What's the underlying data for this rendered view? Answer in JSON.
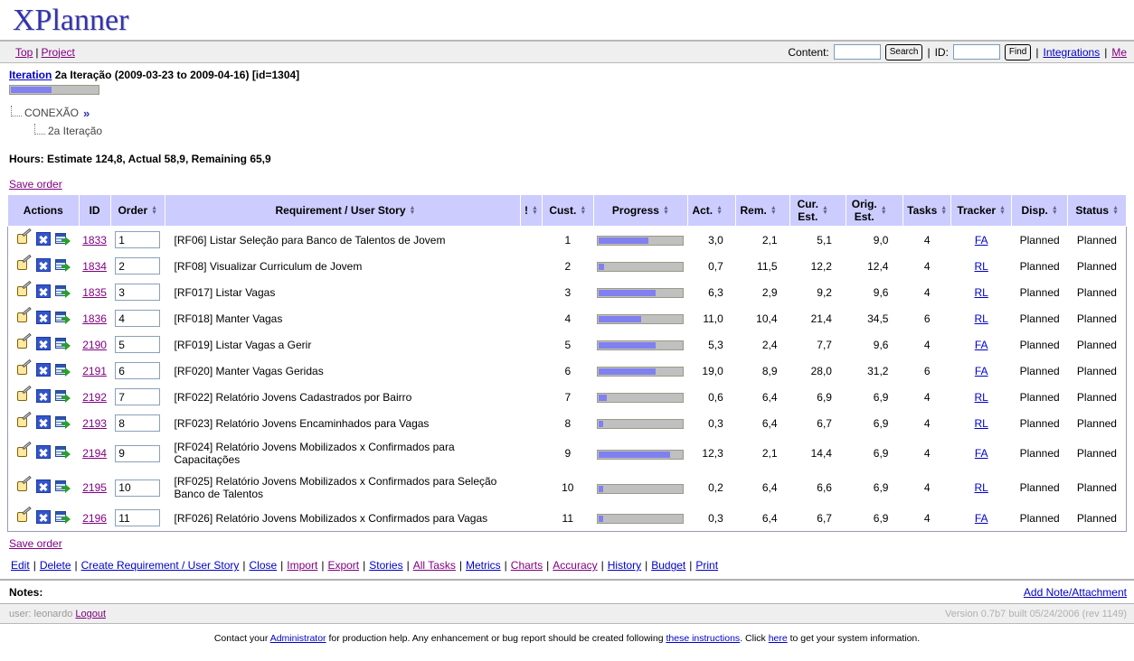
{
  "app": {
    "title": "XPlanner"
  },
  "nav": {
    "left": [
      {
        "label": "Top",
        "name": "nav-link-top",
        "visited": true
      },
      {
        "label": "Project",
        "name": "nav-link-project",
        "visited": true
      }
    ],
    "content_label": "Content:",
    "content_value": "",
    "content_placeholder": "",
    "search_button": "Search",
    "id_label": "ID:",
    "id_value": "",
    "id_placeholder": "",
    "find_button": "Find",
    "integrations_label": "Integrations",
    "me_label": "Me"
  },
  "iteration": {
    "label": "Iteration",
    "description": "2a Iteração (2009-03-23 to 2009-04-16) [id=1304]",
    "progress_percent": 47
  },
  "tree": {
    "project": "CONEXÃO",
    "chevron": "»",
    "child": "2a Iteração"
  },
  "hours": {
    "text": "Hours: Estimate 124,8, Actual 58,9, Remaining 65,9"
  },
  "save_order_label": "Save order",
  "table": {
    "columns": [
      {
        "key": "actions",
        "label": "Actions",
        "sortable": false
      },
      {
        "key": "id",
        "label": "ID",
        "sortable": false
      },
      {
        "key": "order",
        "label": "Order",
        "sortable": true
      },
      {
        "key": "req",
        "label": "Requirement / User Story",
        "sortable": true
      },
      {
        "key": "excl",
        "label": "!",
        "sortable": true
      },
      {
        "key": "cust",
        "label": "Cust.",
        "sortable": true
      },
      {
        "key": "progress",
        "label": "Progress",
        "sortable": true
      },
      {
        "key": "act",
        "label": "Act.",
        "sortable": true
      },
      {
        "key": "rem",
        "label": "Rem.",
        "sortable": true
      },
      {
        "key": "cur",
        "label": "Cur. Est.",
        "sortable": true
      },
      {
        "key": "orig",
        "label": "Orig. Est.",
        "sortable": true
      },
      {
        "key": "tasks",
        "label": "Tasks",
        "sortable": true
      },
      {
        "key": "tracker",
        "label": "Tracker",
        "sortable": true
      },
      {
        "key": "disp",
        "label": "Disp.",
        "sortable": true
      },
      {
        "key": "status",
        "label": "Status",
        "sortable": true
      }
    ],
    "rows": [
      {
        "id": "1833",
        "order": "1",
        "req": "[RF06] Listar Seleção para Banco de Talentos de Jovem",
        "cust": "1",
        "progress": 59,
        "act": "3,0",
        "rem": "2,1",
        "cur": "5,1",
        "orig": "9,0",
        "tasks": "4",
        "tracker": "FA",
        "disp": "Planned",
        "status": "Planned"
      },
      {
        "id": "1834",
        "order": "2",
        "req": "[RF08] Visualizar Curriculum de Jovem",
        "cust": "2",
        "progress": 6,
        "act": "0,7",
        "rem": "11,5",
        "cur": "12,2",
        "orig": "12,4",
        "tasks": "4",
        "tracker": "RL",
        "disp": "Planned",
        "status": "Planned"
      },
      {
        "id": "1835",
        "order": "3",
        "req": "[RF017] Listar Vagas",
        "cust": "3",
        "progress": 68,
        "act": "6,3",
        "rem": "2,9",
        "cur": "9,2",
        "orig": "9,6",
        "tasks": "4",
        "tracker": "RL",
        "disp": "Planned",
        "status": "Planned"
      },
      {
        "id": "1836",
        "order": "4",
        "req": "[RF018] Manter Vagas",
        "cust": "4",
        "progress": 51,
        "act": "11,0",
        "rem": "10,4",
        "cur": "21,4",
        "orig": "34,5",
        "tasks": "6",
        "tracker": "RL",
        "disp": "Planned",
        "status": "Planned"
      },
      {
        "id": "2190",
        "order": "5",
        "req": "[RF019] Listar Vagas a Gerir",
        "cust": "5",
        "progress": 68,
        "act": "5,3",
        "rem": "2,4",
        "cur": "7,7",
        "orig": "9,6",
        "tasks": "4",
        "tracker": "FA",
        "disp": "Planned",
        "status": "Planned"
      },
      {
        "id": "2191",
        "order": "6",
        "req": "[RF020] Manter Vagas Geridas",
        "cust": "6",
        "progress": 68,
        "act": "19,0",
        "rem": "8,9",
        "cur": "28,0",
        "orig": "31,2",
        "tasks": "6",
        "tracker": "FA",
        "disp": "Planned",
        "status": "Planned"
      },
      {
        "id": "2192",
        "order": "7",
        "req": "[RF022] Relatório Jovens Cadastrados por Bairro",
        "cust": "7",
        "progress": 9,
        "act": "0,6",
        "rem": "6,4",
        "cur": "6,9",
        "orig": "6,9",
        "tasks": "4",
        "tracker": "RL",
        "disp": "Planned",
        "status": "Planned"
      },
      {
        "id": "2193",
        "order": "8",
        "req": "[RF023] Relatório Jovens Encaminhados para Vagas",
        "cust": "8",
        "progress": 5,
        "act": "0,3",
        "rem": "6,4",
        "cur": "6,7",
        "orig": "6,9",
        "tasks": "4",
        "tracker": "RL",
        "disp": "Planned",
        "status": "Planned"
      },
      {
        "id": "2194",
        "order": "9",
        "req": "[RF024] Relatório Jovens Mobilizados x Confirmados para Capacitações",
        "cust": "9",
        "progress": 85,
        "act": "12,3",
        "rem": "2,1",
        "cur": "14,4",
        "orig": "6,9",
        "tasks": "4",
        "tracker": "FA",
        "disp": "Planned",
        "status": "Planned"
      },
      {
        "id": "2195",
        "order": "10",
        "req": "[RF025] Relatório Jovens Mobilizados x Confirmados para Seleção Banco de Talentos",
        "cust": "10",
        "progress": 5,
        "act": "0,2",
        "rem": "6,4",
        "cur": "6,6",
        "orig": "6,9",
        "tasks": "4",
        "tracker": "RL",
        "disp": "Planned",
        "status": "Planned"
      },
      {
        "id": "2196",
        "order": "11",
        "req": "[RF026] Relatório Jovens Mobilizados x Confirmados para Vagas",
        "cust": "11",
        "progress": 5,
        "act": "0,3",
        "rem": "6,4",
        "cur": "6,7",
        "orig": "6,9",
        "tasks": "4",
        "tracker": "FA",
        "disp": "Planned",
        "status": "Planned"
      }
    ],
    "row_action_icons": [
      {
        "name": "edit-icon",
        "title": "Edit"
      },
      {
        "name": "delete-icon",
        "title": "Delete"
      },
      {
        "name": "move-icon",
        "title": "Move / Continue"
      }
    ]
  },
  "bottom_menu": [
    {
      "label": "Edit",
      "visited": false
    },
    {
      "label": "Delete",
      "visited": false
    },
    {
      "label": "Create Requirement / User Story",
      "visited": false
    },
    {
      "label": "Close",
      "visited": false
    },
    {
      "label": "Import",
      "visited": true
    },
    {
      "label": "Export",
      "visited": true
    },
    {
      "label": "Stories",
      "visited": false
    },
    {
      "label": "All Tasks",
      "visited": true
    },
    {
      "label": "Metrics",
      "visited": false
    },
    {
      "label": "Charts",
      "visited": true
    },
    {
      "label": "Accuracy",
      "visited": true
    },
    {
      "label": "History",
      "visited": false
    },
    {
      "label": "Budget",
      "visited": false
    },
    {
      "label": "Print",
      "visited": false
    }
  ],
  "notes": {
    "label": "Notes:",
    "add_link": "Add Note/Attachment"
  },
  "status": {
    "user_text": "user: leonardo",
    "logout": "Logout",
    "version": "Version 0.7b7 built 05/24/2006 (rev 1149)"
  },
  "footer": {
    "part1": "Contact your ",
    "admin_link": "Administrator",
    "part2": " for production help. Any enhancement or bug report should be created following ",
    "instructions_link": "these instructions",
    "part3": ". Click ",
    "here_link": "here",
    "part4": " to get your system information."
  },
  "colors": {
    "accent": "#3333aa",
    "header_bg": "#ccccff",
    "progress_fill": "#8080f0",
    "progress_track": "#c0c0c0",
    "link": "#0000cc",
    "link_visited": "#800080"
  }
}
